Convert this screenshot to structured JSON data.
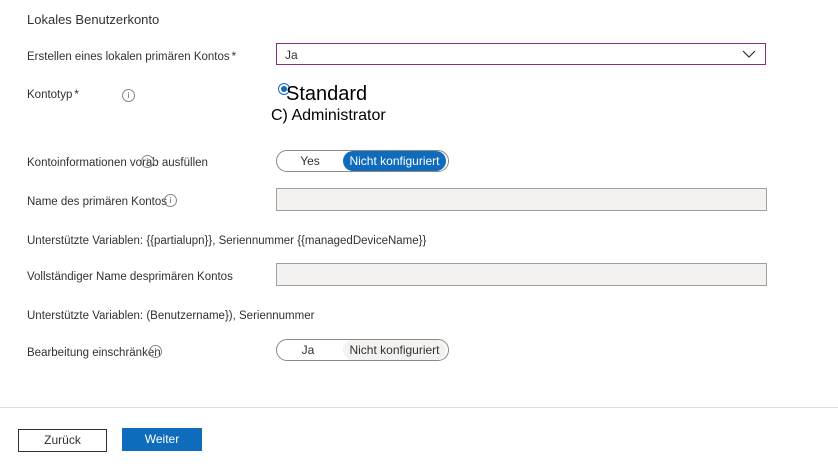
{
  "section": {
    "title": "Lokales Benutzerkonto"
  },
  "create_primary": {
    "label": "Erstellen eines lokalen primären Kontos",
    "required_mark": "*",
    "value": "Ja"
  },
  "account_type": {
    "label": "Kontotyp",
    "required_mark": "*",
    "info_glyph": "i",
    "options": [
      {
        "label": "Standard",
        "selected": true
      },
      {
        "label": "C) Administrator",
        "selected": false
      }
    ]
  },
  "prefill": {
    "label": "Kontoinformationen vorab ausfüllen",
    "toggle": {
      "left": "Yes",
      "right": "Nicht konfiguriert",
      "selected": "right"
    }
  },
  "primary_name": {
    "label": "Name des primären Kontos",
    "value": "",
    "hint": "Unterstützte Variablen: {{partialupn}}, Seriennummer {{managedDeviceName}}"
  },
  "full_name": {
    "label": "Vollständiger Name desprimären Kontos",
    "value": "",
    "hint": "Unterstützte Variablen: (Benutzername}), Seriennummer"
  },
  "restrict_edit": {
    "label": "Bearbeitung einschränken",
    "toggle": {
      "left": "Ja",
      "right": "Nicht konfiguriert",
      "selected": "right"
    }
  },
  "footer": {
    "back_label": "Zurück",
    "next_label": "Weiter"
  },
  "colors": {
    "accent": "#0f6cbd",
    "focus_border": "#8a2f7f",
    "input_bg": "#f3f2f1"
  },
  "icons": {
    "info": "info-icon",
    "dropdown": "chevron-down-icon"
  }
}
